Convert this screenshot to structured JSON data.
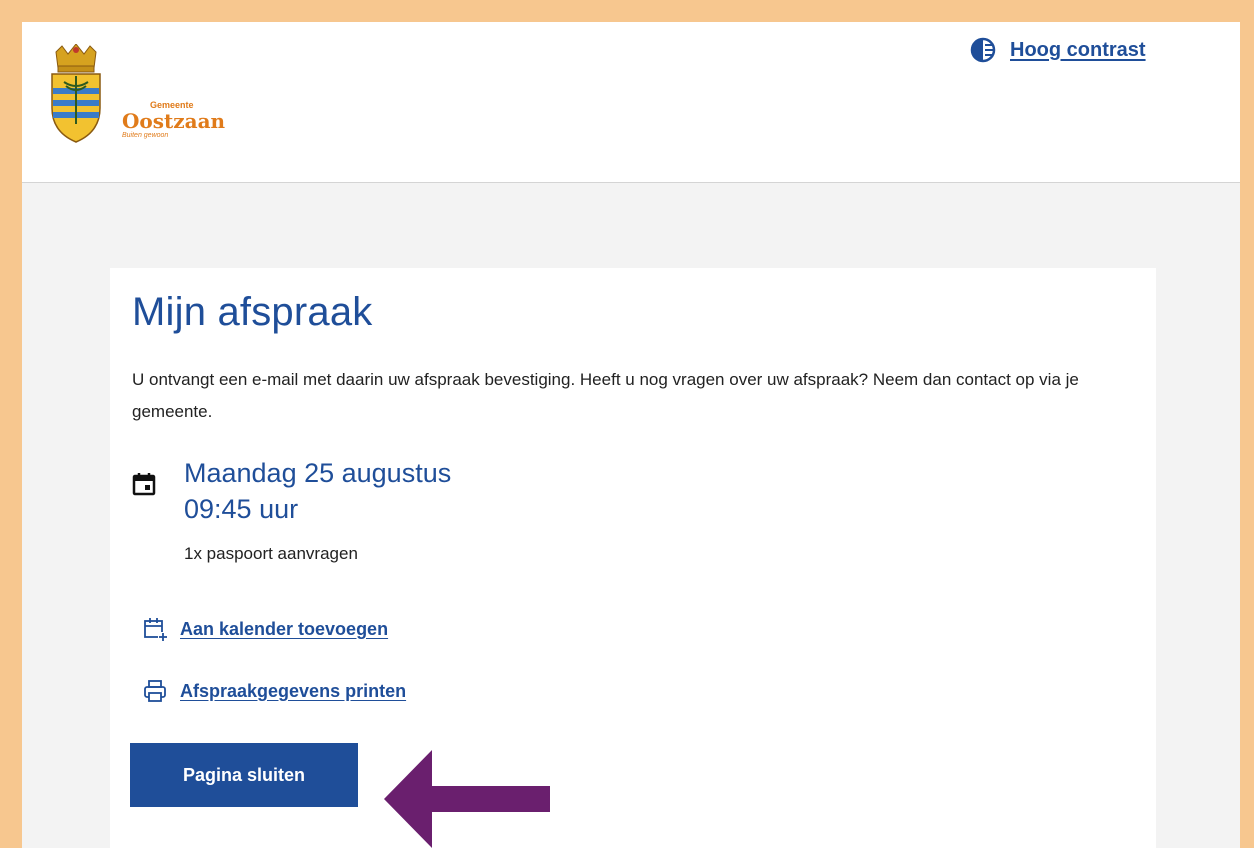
{
  "header": {
    "logo": {
      "line1": "Gemeente",
      "line2": "Oostzaan",
      "line3": "Buiten gewoon"
    },
    "contrast_link": "Hoog contrast",
    "contrast_icon": "contrast-icon"
  },
  "main": {
    "title": "Mijn afspraak",
    "intro": "U ontvangt een e-mail met daarin uw afspraak bevestiging. Heeft u nog vragen over uw afspraak? Neem dan contact op via je gemeente.",
    "appointment": {
      "icon": "calendar-icon",
      "date": "Maandag 25 augustus",
      "time": "09:45 uur",
      "service": "1x paspoort aanvragen"
    },
    "actions": {
      "add_calendar": {
        "label": "Aan kalender toevoegen",
        "icon": "calendar-add-icon"
      },
      "print": {
        "label": "Afspraakgegevens printen",
        "icon": "printer-icon"
      }
    },
    "close_button": "Pagina sluiten"
  },
  "annotation": {
    "arrow_color": "#6a1f6e"
  },
  "colors": {
    "primary": "#1f4e99",
    "border": "#f7c78f",
    "background": "#f3f3f3",
    "logo": "#e07b1a"
  }
}
